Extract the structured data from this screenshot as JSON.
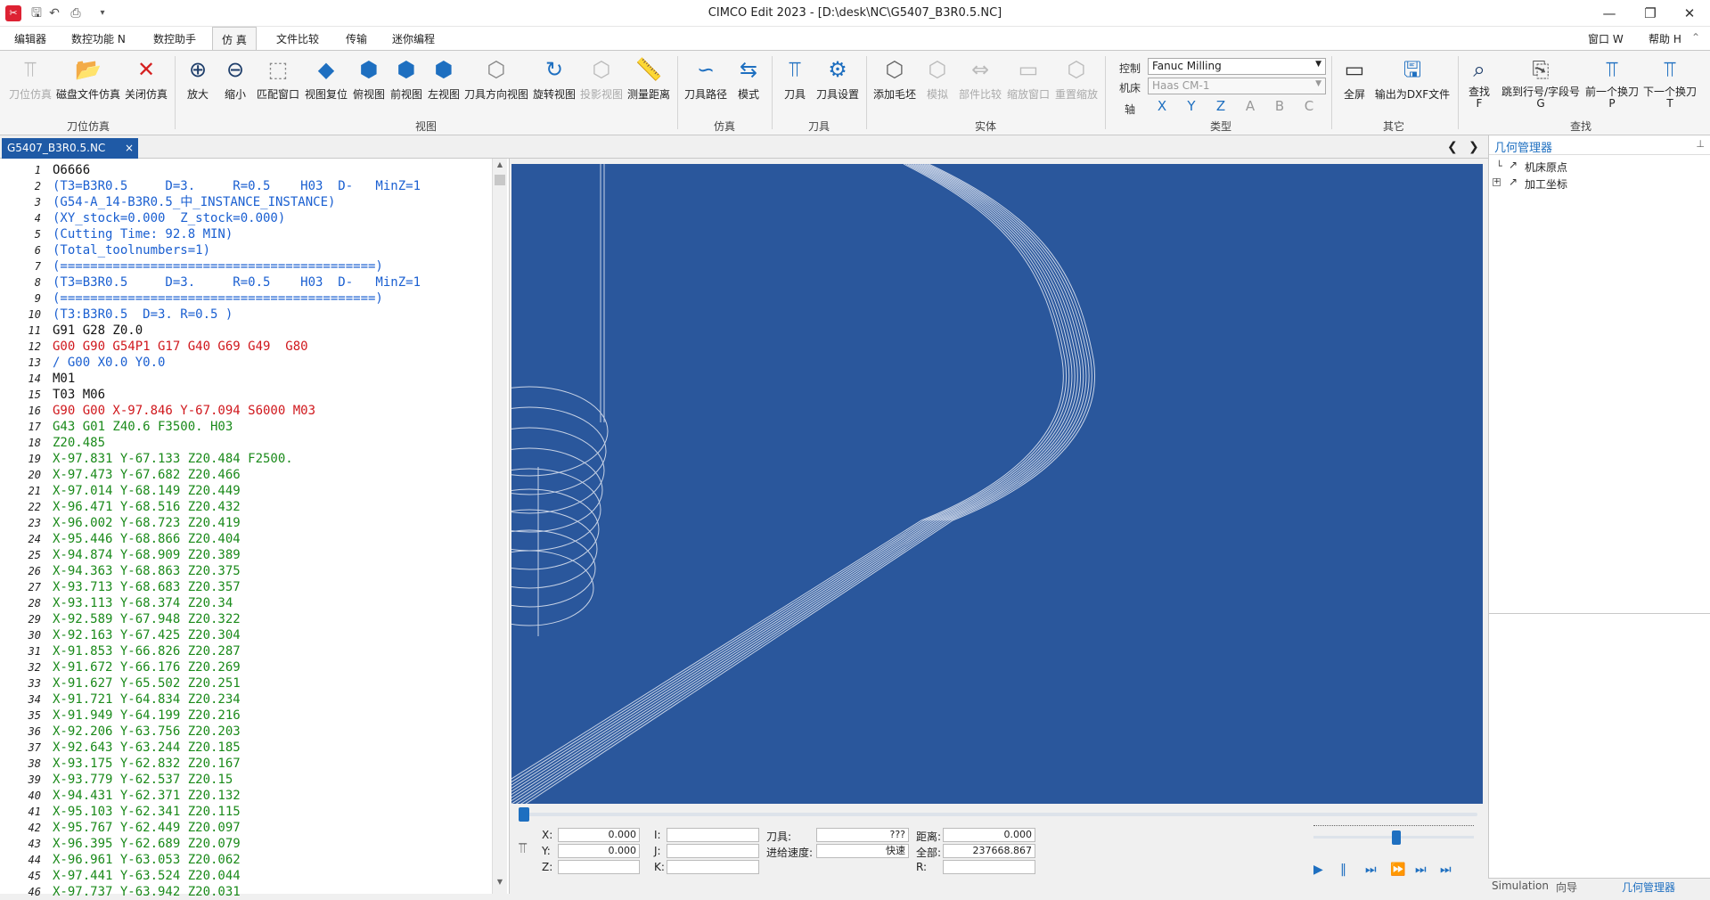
{
  "window": {
    "title": "CIMCO Edit 2023 - [D:\\desk\\NC\\G5407_B3R0.5.NC]",
    "right_menu": [
      "窗口 W",
      "帮助 H"
    ]
  },
  "menu": [
    "编辑器",
    "数控功能 N",
    "数控助手",
    "仿 真",
    "文件比较",
    "传输",
    "迷你编程"
  ],
  "ribbon": {
    "groups": [
      {
        "label": "刀位仿真",
        "buttons": [
          "刀位仿真",
          "磁盘文件仿真",
          "关闭仿真"
        ]
      },
      {
        "label": "视图",
        "buttons": [
          "放大",
          "缩小",
          "匹配窗口",
          "视图复位",
          "俯视图",
          "前视图",
          "左视图",
          "刀具方向视图",
          "旋转视图",
          "投影视图",
          "测量距离"
        ]
      },
      {
        "label": "仿真",
        "buttons": [
          "刀具路径",
          "模式"
        ]
      },
      {
        "label": "刀具",
        "buttons": [
          "刀具",
          "刀具设置"
        ]
      },
      {
        "label": "实体",
        "buttons": [
          "添加毛坯",
          "模拟",
          "部件比较",
          "缩放窗口",
          "重置缩放"
        ]
      },
      {
        "label": "类型",
        "control_label": "控制",
        "machine_label": "机床",
        "axis_label": "轴",
        "control_value": "Fanuc Milling",
        "machine_value": "Haas CM-1",
        "axes": [
          "X",
          "Y",
          "Z",
          "A",
          "B",
          "C"
        ]
      },
      {
        "label": "其它",
        "buttons": [
          "全屏",
          "输出为DXF文件"
        ]
      },
      {
        "label": "查找",
        "buttons": [
          "查找\nF",
          "跳到行号/字段号\nG",
          "前一个换刀\nP",
          "下一个换刀\nT"
        ]
      }
    ]
  },
  "tab": {
    "name": "G5407_B3R0.5.NC",
    "close": "×"
  },
  "code_lines": [
    {
      "n": "1",
      "t": "O6666",
      "c": "c-black"
    },
    {
      "n": "2",
      "t": "(T3=B3R0.5     D=3.     R=0.5    H03  D-   MinZ=1",
      "c": "c-blue"
    },
    {
      "n": "3",
      "t": "(G54-A_14-B3R0.5_中_INSTANCE_INSTANCE)",
      "c": "c-blue"
    },
    {
      "n": "4",
      "t": "(XY_stock=0.000  Z_stock=0.000)",
      "c": "c-blue"
    },
    {
      "n": "5",
      "t": "(Cutting Time: 92.8 MIN)",
      "c": "c-blue"
    },
    {
      "n": "6",
      "t": "(Total_toolnumbers=1)",
      "c": "c-blue"
    },
    {
      "n": "7",
      "t": "(==========================================)",
      "c": "c-blue"
    },
    {
      "n": "8",
      "t": "(T3=B3R0.5     D=3.     R=0.5    H03  D-   MinZ=1",
      "c": "c-blue"
    },
    {
      "n": "9",
      "t": "(==========================================)",
      "c": "c-blue"
    },
    {
      "n": "10",
      "t": "(T3:B3R0.5  D=3. R=0.5 )",
      "c": "c-blue"
    },
    {
      "n": "11",
      "t": "G91 G28 Z0.0",
      "c": "c-black"
    },
    {
      "n": "12",
      "t": "G00 G90 G54P1 G17 G40 G69 G49  G80",
      "c": "c-red"
    },
    {
      "n": "13",
      "t": "/ G00 X0.0 Y0.0",
      "c": "c-blue"
    },
    {
      "n": "14",
      "t": "M01",
      "c": "c-black"
    },
    {
      "n": "15",
      "t": "T03 M06",
      "c": "c-black"
    },
    {
      "n": "16",
      "t": "G90 G00 X-97.846 Y-67.094 S6000 M03",
      "c": "c-red"
    },
    {
      "n": "17",
      "t": "G43 G01 Z40.6 F3500. H03",
      "c": "c-green"
    },
    {
      "n": "18",
      "t": "Z20.485",
      "c": "c-green"
    },
    {
      "n": "19",
      "t": "X-97.831 Y-67.133 Z20.484 F2500.",
      "c": "c-green"
    },
    {
      "n": "20",
      "t": "X-97.473 Y-67.682 Z20.466",
      "c": "c-green"
    },
    {
      "n": "21",
      "t": "X-97.014 Y-68.149 Z20.449",
      "c": "c-green"
    },
    {
      "n": "22",
      "t": "X-96.471 Y-68.516 Z20.432",
      "c": "c-green"
    },
    {
      "n": "23",
      "t": "X-96.002 Y-68.723 Z20.419",
      "c": "c-green"
    },
    {
      "n": "24",
      "t": "X-95.446 Y-68.866 Z20.404",
      "c": "c-green"
    },
    {
      "n": "25",
      "t": "X-94.874 Y-68.909 Z20.389",
      "c": "c-green"
    },
    {
      "n": "26",
      "t": "X-94.363 Y-68.863 Z20.375",
      "c": "c-green"
    },
    {
      "n": "27",
      "t": "X-93.713 Y-68.683 Z20.357",
      "c": "c-green"
    },
    {
      "n": "28",
      "t": "X-93.113 Y-68.374 Z20.34",
      "c": "c-green"
    },
    {
      "n": "29",
      "t": "X-92.589 Y-67.948 Z20.322",
      "c": "c-green"
    },
    {
      "n": "30",
      "t": "X-92.163 Y-67.425 Z20.304",
      "c": "c-green"
    },
    {
      "n": "31",
      "t": "X-91.853 Y-66.826 Z20.287",
      "c": "c-green"
    },
    {
      "n": "32",
      "t": "X-91.672 Y-66.176 Z20.269",
      "c": "c-green"
    },
    {
      "n": "33",
      "t": "X-91.627 Y-65.502 Z20.251",
      "c": "c-green"
    },
    {
      "n": "34",
      "t": "X-91.721 Y-64.834 Z20.234",
      "c": "c-green"
    },
    {
      "n": "35",
      "t": "X-91.949 Y-64.199 Z20.216",
      "c": "c-green"
    },
    {
      "n": "36",
      "t": "X-92.206 Y-63.756 Z20.203",
      "c": "c-green"
    },
    {
      "n": "37",
      "t": "X-92.643 Y-63.244 Z20.185",
      "c": "c-green"
    },
    {
      "n": "38",
      "t": "X-93.175 Y-62.832 Z20.167",
      "c": "c-green"
    },
    {
      "n": "39",
      "t": "X-93.779 Y-62.537 Z20.15",
      "c": "c-green"
    },
    {
      "n": "40",
      "t": "X-94.431 Y-62.371 Z20.132",
      "c": "c-green"
    },
    {
      "n": "41",
      "t": "X-95.103 Y-62.341 Z20.115",
      "c": "c-green"
    },
    {
      "n": "42",
      "t": "X-95.767 Y-62.449 Z20.097",
      "c": "c-green"
    },
    {
      "n": "43",
      "t": "X-96.395 Y-62.689 Z20.079",
      "c": "c-green"
    },
    {
      "n": "44",
      "t": "X-96.961 Y-63.053 Z20.062",
      "c": "c-green"
    },
    {
      "n": "45",
      "t": "X-97.441 Y-63.524 Z20.044",
      "c": "c-green"
    },
    {
      "n": "46",
      "t": "X-97.737 Y-63.942 Z20.031",
      "c": "c-green"
    }
  ],
  "sim": {
    "x_label": "X:",
    "x_val": "0.000",
    "y_label": "Y:",
    "y_val": "0.000",
    "z_label": "Z:",
    "z_val": "0.000",
    "i_label": "I:",
    "j_label": "J:",
    "k_label": "K:",
    "tool_label": "刀具:",
    "tool_val": "???",
    "feed_label": "进给速度:",
    "feed_val": "快速",
    "dist_label": "距离:",
    "dist_val": "0.000",
    "total_label": "全部:",
    "total_val": "237668.867",
    "r_label": "R:"
  },
  "side": {
    "title": "几何管理器",
    "items": [
      "机床原点",
      "加工坐标"
    ],
    "bottom_tabs": [
      "Simulation",
      "向导",
      "几何管理器"
    ]
  },
  "colors": {
    "viewport_bg": "#2a579c",
    "toolpath": "#c8d3e6",
    "accent": "#1e6fc0"
  }
}
